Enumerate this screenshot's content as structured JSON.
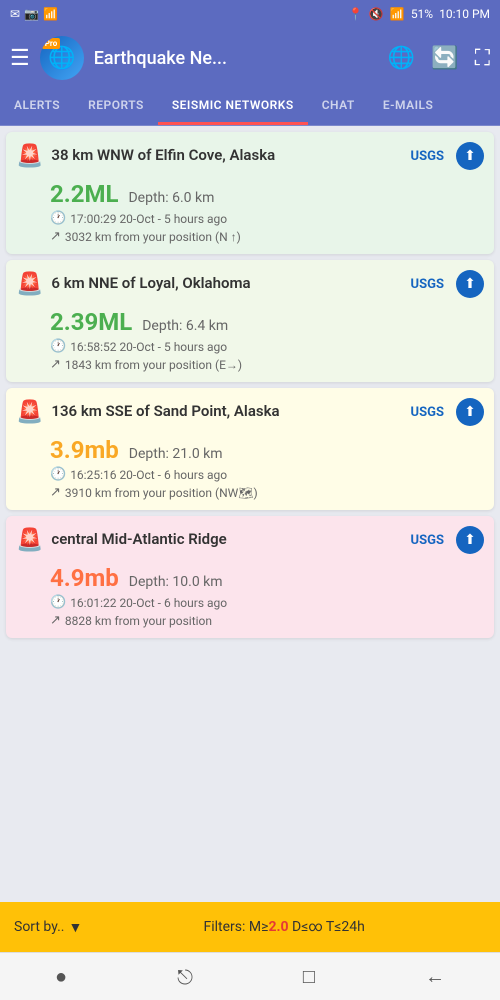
{
  "statusBar": {
    "leftIcons": [
      "✉",
      "📷",
      "📶"
    ],
    "battery": "51%",
    "time": "10:10 PM",
    "signalBars": "▲"
  },
  "header": {
    "title": "Earthquake Ne...",
    "proLabel": "Pro"
  },
  "tabs": [
    {
      "id": "alerts",
      "label": "ALERTS",
      "active": false
    },
    {
      "id": "reports",
      "label": "REPORTS",
      "active": false
    },
    {
      "id": "seismic",
      "label": "SEISMIC NETWORKS",
      "active": true
    },
    {
      "id": "chat",
      "label": "CHAT",
      "active": false
    },
    {
      "id": "emails",
      "label": "E-MAILS",
      "active": false
    }
  ],
  "earthquakes": [
    {
      "id": 1,
      "colorClass": "green",
      "location": "38 km WNW of Elfin Cove, Alaska",
      "source": "USGS",
      "magnitude": "2.2ML",
      "magnitudeColor": "green",
      "depth": "Depth: 6.0 km",
      "time": "17:00:29 20-Oct - 5 hours ago",
      "distance": "3032 km from your position (N ↑)"
    },
    {
      "id": 2,
      "colorClass": "light-green",
      "location": "6 km NNE of Loyal, Oklahoma",
      "source": "USGS",
      "magnitude": "2.39ML",
      "magnitudeColor": "green",
      "depth": "Depth: 6.4 km",
      "time": "16:58:52 20-Oct - 5 hours ago",
      "distance": "1843 km from your position (E→)"
    },
    {
      "id": 3,
      "colorClass": "yellow",
      "location": "136 km SSE of Sand Point, Alaska",
      "source": "USGS",
      "magnitude": "3.9mb",
      "magnitudeColor": "yellow-mag",
      "depth": "Depth: 21.0 km",
      "time": "16:25:16 20-Oct - 6 hours ago",
      "distance": "3910 km from your position (NW🗺)"
    },
    {
      "id": 4,
      "colorClass": "pink",
      "location": "central Mid-Atlantic Ridge",
      "source": "USGS",
      "magnitude": "4.9mb",
      "magnitudeColor": "orange-mag",
      "depth": "Depth: 10.0 km",
      "time": "16:01:22 20-Oct - 6 hours ago",
      "distance": "8828 km from your position"
    }
  ],
  "bottomBar": {
    "sortLabel": "Sort by..",
    "filtersPrefix": "Filters: M≥",
    "filtersM": "2.0",
    "filtersSuffix": " D≤∞ T≤24h"
  },
  "nav": {
    "icons": [
      "●",
      "⎋",
      "□",
      "←"
    ]
  }
}
